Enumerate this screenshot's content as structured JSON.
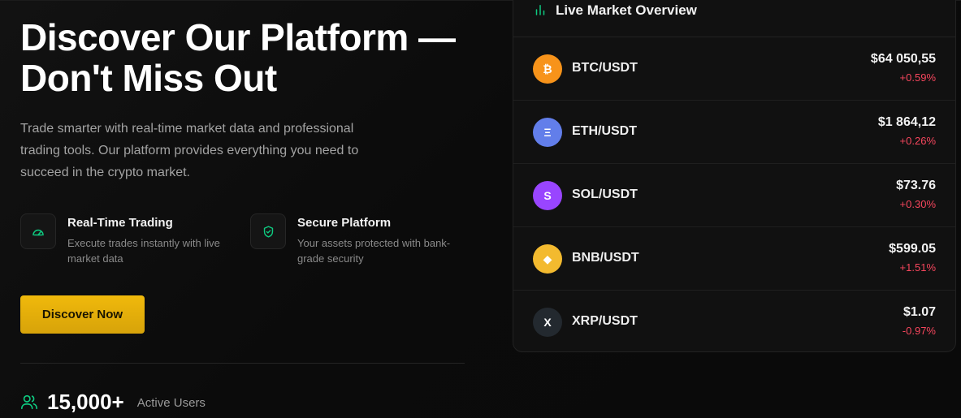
{
  "hero": {
    "title": "Discover Our Platform — Don't Miss Out",
    "description": "Trade smarter with real-time market data and professional trading tools. Our platform provides everything you need to succeed in the crypto market."
  },
  "features": [
    {
      "title": "Real-Time Trading",
      "description": "Execute trades instantly with live market data",
      "icon": "speedometer-icon"
    },
    {
      "title": "Secure Platform",
      "description": "Your assets protected with bank-grade security",
      "icon": "shield-check-icon"
    }
  ],
  "cta": {
    "label": "Discover Now"
  },
  "stats": {
    "value": "15,000+",
    "label": "Active Users",
    "icon": "users-icon"
  },
  "market": {
    "title": "Live Market Overview",
    "icon": "bar-chart-icon",
    "rows": [
      {
        "symbol": "₿",
        "pair": "BTC/USDT",
        "price": "$64 050,55",
        "change": "+0.59%",
        "color": "#f7931a"
      },
      {
        "symbol": "Ξ",
        "pair": "ETH/USDT",
        "price": "$1 864,12",
        "change": "+0.26%",
        "color": "#627eea"
      },
      {
        "symbol": "S",
        "pair": "SOL/USDT",
        "price": "$73.76",
        "change": "+0.30%",
        "color": "#9945ff"
      },
      {
        "symbol": "◆",
        "pair": "BNB/USDT",
        "price": "$599.05",
        "change": "+1.51%",
        "color": "#f3ba2f"
      },
      {
        "symbol": "X",
        "pair": "XRP/USDT",
        "price": "$1.07",
        "change": "-0.97%",
        "color": "#23292f"
      }
    ]
  },
  "colors": {
    "accent": "#f0b90b",
    "positive_green": "#0ecb81",
    "change_red": "#f6465d"
  }
}
